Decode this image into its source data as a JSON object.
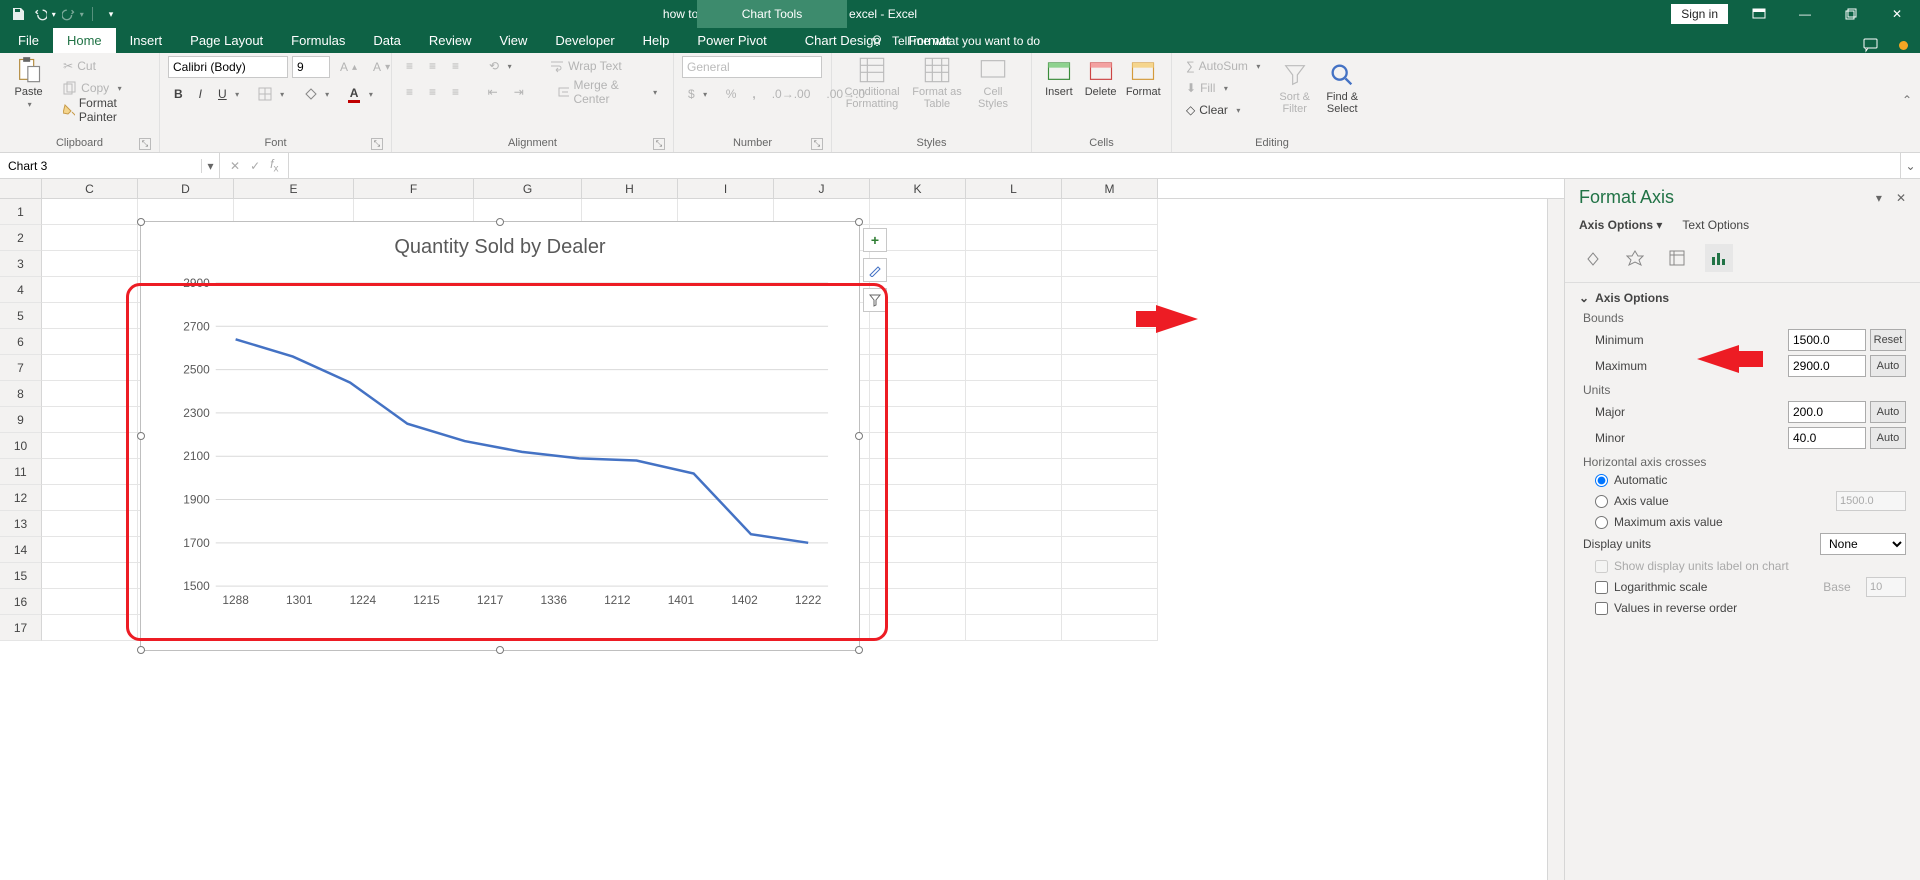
{
  "titlebar": {
    "doc": "how to change scale on a graph in excel  -  Excel",
    "chart_tools": "Chart Tools",
    "signin": "Sign in"
  },
  "tabs": {
    "file": "File",
    "home": "Home",
    "insert": "Insert",
    "page": "Page Layout",
    "formulas": "Formulas",
    "data": "Data",
    "review": "Review",
    "view": "View",
    "developer": "Developer",
    "help": "Help",
    "powerpivot": "Power Pivot",
    "chartdesign": "Chart Design",
    "format": "Format",
    "tellme": "Tell me what you want to do"
  },
  "ribbon": {
    "clipboard": {
      "label": "Clipboard",
      "paste": "Paste",
      "cut": "Cut",
      "copy": "Copy",
      "painter": "Format Painter"
    },
    "font": {
      "label": "Font",
      "name": "Calibri (Body)",
      "size": "9"
    },
    "alignment": {
      "label": "Alignment",
      "wrap": "Wrap Text",
      "merge": "Merge & Center"
    },
    "number": {
      "label": "Number",
      "format": "General"
    },
    "styles": {
      "label": "Styles",
      "cf": "Conditional Formatting",
      "fat": "Format as Table",
      "cs": "Cell Styles"
    },
    "cells": {
      "label": "Cells",
      "insert": "Insert",
      "delete": "Delete",
      "format": "Format"
    },
    "editing": {
      "label": "Editing",
      "autosum": "AutoSum",
      "fill": "Fill",
      "clear": "Clear",
      "sort": "Sort & Filter",
      "find": "Find & Select"
    }
  },
  "namebox": "Chart 3",
  "cols": [
    "C",
    "D",
    "E",
    "F",
    "G",
    "H",
    "I",
    "J",
    "K",
    "L",
    "M"
  ],
  "rownums": [
    "1",
    "2",
    "3",
    "4",
    "5",
    "6",
    "7",
    "8",
    "9",
    "10",
    "11",
    "12",
    "13",
    "14",
    "15",
    "16",
    "17"
  ],
  "chart_data": {
    "type": "line",
    "title": "Quantity Sold by Dealer",
    "categories": [
      "1288",
      "1301",
      "1224",
      "1215",
      "1217",
      "1336",
      "1212",
      "1401",
      "1402",
      "1222"
    ],
    "values": [
      2640,
      2560,
      2440,
      2250,
      2170,
      2120,
      2090,
      2080,
      2020,
      1740,
      1700
    ],
    "ylabels": [
      "2900",
      "2700",
      "2500",
      "2300",
      "2100",
      "1900",
      "1700",
      "1500"
    ],
    "ylim": [
      1500,
      2900
    ],
    "ylabel": "",
    "xlabel": ""
  },
  "chartbtns": {
    "plus": "+",
    "brush": "",
    "filter": ""
  },
  "pane": {
    "title": "Format Axis",
    "tab1": "Axis Options",
    "tab2": "Text Options",
    "section": "Axis Options",
    "bounds": "Bounds",
    "min_l": "Minimum",
    "min_v": "1500.0",
    "min_b": "Reset",
    "max_l": "Maximum",
    "max_v": "2900.0",
    "max_b": "Auto",
    "units": "Units",
    "maj_l": "Major",
    "maj_v": "200.0",
    "maj_b": "Auto",
    "mnr_l": "Minor",
    "mnr_v": "40.0",
    "mnr_b": "Auto",
    "hcross": "Horizontal axis crosses",
    "r_auto": "Automatic",
    "r_val": "Axis value",
    "r_val_v": "1500.0",
    "r_max": "Maximum axis value",
    "dunits": "Display units",
    "dunits_v": "None",
    "dshow": "Show display units label on chart",
    "log": "Logarithmic scale",
    "log_base": "Base",
    "log_v": "10",
    "rev": "Values in reverse order"
  }
}
